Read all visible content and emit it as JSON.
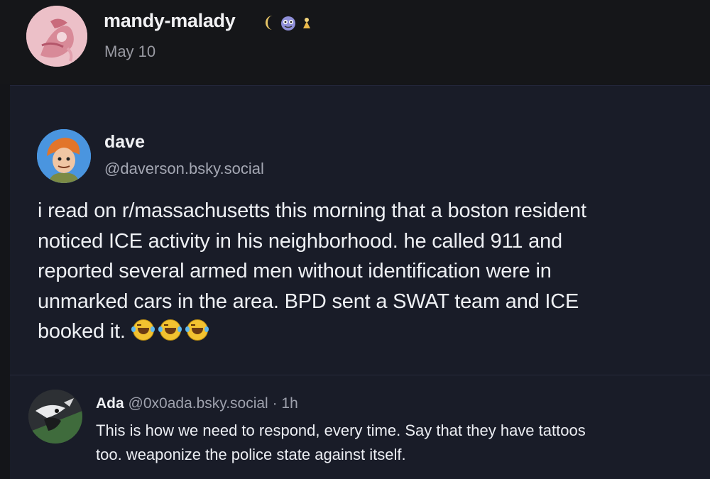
{
  "header": {
    "username": "mandy-malady",
    "date": "May 10",
    "badges": [
      "moon-icon",
      "frog-face-icon",
      "sparkle-icon"
    ]
  },
  "quoted_post": {
    "display_name": "dave",
    "handle": "@daverson.bsky.social",
    "body_lines": [
      "i read on r/massachusetts this morning that a boston resident",
      "noticed ICE activity in his neighborhood. he called 911 and",
      "reported several armed men without identification were in",
      "unmarked cars in the area. BPD sent a SWAT team and ICE",
      "booked it."
    ],
    "emojis": [
      "rolling-laughing-emoji",
      "rolling-laughing-emoji",
      "rolling-laughing-emoji"
    ]
  },
  "reply": {
    "display_name": "Ada",
    "handle": "@0x0ada.bsky.social",
    "separator": "·",
    "time": "1h",
    "body_lines": [
      "This is how we need to respond, every time. Say that they have tattoos",
      "too. weaponize the police state against itself."
    ]
  },
  "colors": {
    "background": "#141519",
    "card": "#191c28",
    "text": "#eef0f4",
    "muted": "#a4a7b3"
  }
}
